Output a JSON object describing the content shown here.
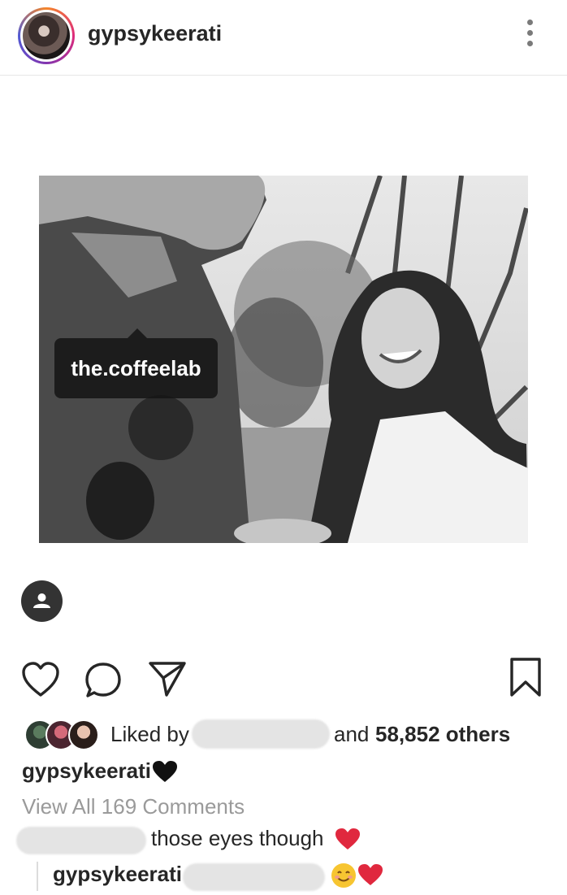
{
  "post": {
    "username": "gypsykeerati",
    "photo_tag": "the.coffeelab",
    "likes_prefix": "Liked by",
    "likes_suffix_and": "and",
    "likes_count": "58,852 others",
    "caption_user": "gypsykeerati",
    "view_all_comments": "View All 169 Comments",
    "comment_text": "those eyes though",
    "reply_user": "gypsykeerati"
  },
  "icons": {
    "more": "vertical-dots-icon",
    "like": "heart-outline-icon",
    "comment": "speech-bubble-icon",
    "share": "paper-plane-icon",
    "save": "bookmark-icon",
    "tagged": "person-icon"
  },
  "colors": {
    "text": "#262626",
    "muted": "#9a9a9a",
    "heart_red": "#e0283e"
  }
}
